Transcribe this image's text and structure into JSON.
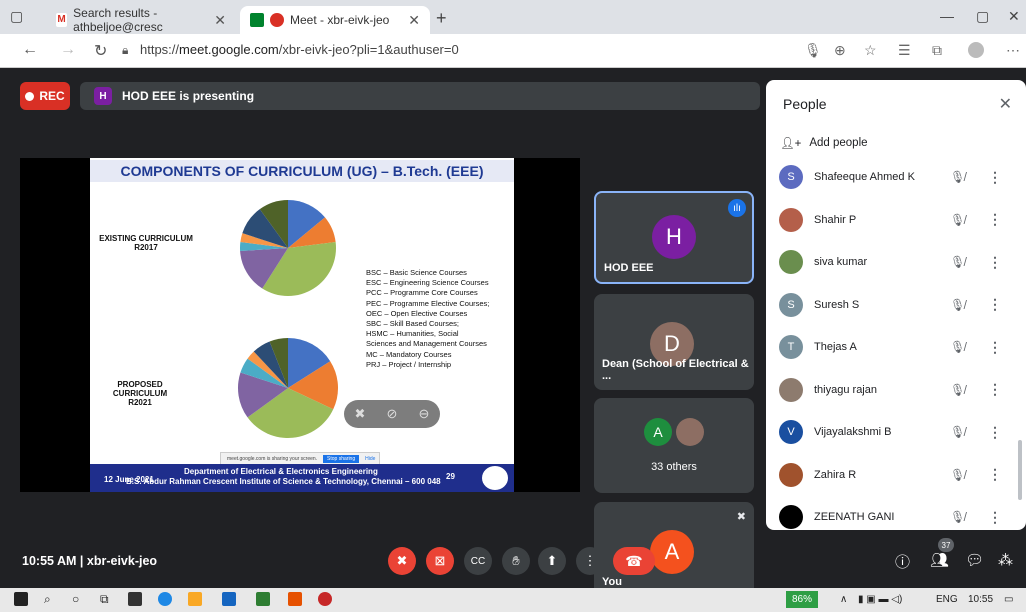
{
  "browser": {
    "tabs": [
      {
        "label": "Search results - athbeljoe@cresc",
        "active": false
      },
      {
        "label": "Meet - xbr-eivk-jeo",
        "active": true
      }
    ],
    "url_prefix": "https://",
    "url_host": "meet.google.com",
    "url_path": "/xbr-eivk-jeo?pli=1&authuser=0"
  },
  "meet": {
    "rec_label": "REC",
    "presenter_initial": "H",
    "presenting_text": "HOD EEE is presenting",
    "slide": {
      "title": "COMPONENTS OF CURRICULUM (UG) – B.Tech. (EEE)",
      "existing_label_1": "EXISTING CURRICULUM",
      "existing_label_2": "R2017",
      "proposed_label_1": "PROPOSED CURRICULUM",
      "proposed_label_2": "R2021",
      "legend": [
        "BSC – Basic Science Courses",
        "ESC – Engineering Science Courses",
        "PCC – Programme Core Courses",
        "PEC – Programme Elective Courses;",
        "OEC – Open Elective Courses",
        "SBC – Skill Based Courses;",
        "HSMC – Humanities, Social",
        "Sciences and Management Courses",
        "MC – Mandatory Courses",
        "PRJ – Project / Internship"
      ],
      "share_text": "meet.google.com is sharing your screen.",
      "stop_sharing": "Stop sharing",
      "hide": "Hide",
      "footer_date": "12 June 2021",
      "footer_dept": "Department of Electrical & Electronics Engineering",
      "footer_inst": "B.S. Abdur Rahman Crescent Institute of Science & Technology, Chennai – 600 048",
      "footer_page": "29",
      "pie_colors": [
        "#4472c4",
        "#ed7d31",
        "#9bbb59",
        "#8064a2",
        "#4bacc6",
        "#f79646",
        "#2c4d75",
        "#4f6228"
      ]
    },
    "tiles": [
      {
        "initial": "H",
        "name": "HOD EEE",
        "color": "#7b1fa2"
      },
      {
        "initial": "D",
        "name": "Dean (School of Electrical & ...",
        "color": "#8d6e63"
      },
      {
        "initial": "A",
        "name": "33 others",
        "color": "#1e8e3e"
      },
      {
        "initial": "A",
        "name": "You",
        "color": "#f4511e"
      }
    ],
    "clock": "10:55 AM",
    "separator": "|",
    "meeting_code": "xbr-eivk-jeo",
    "people_count": "37"
  },
  "people": {
    "title": "People",
    "add_people": "Add people",
    "list": [
      {
        "initial": "S",
        "name": "Shafeeque Ahmed K",
        "color": "#5c6bc0"
      },
      {
        "initial": "",
        "name": "Shahir P",
        "color": "#b45f4a"
      },
      {
        "initial": "",
        "name": "siva kumar",
        "color": "#6a8e4e"
      },
      {
        "initial": "S",
        "name": "Suresh S",
        "color": "#78909c"
      },
      {
        "initial": "T",
        "name": "Thejas A",
        "color": "#78909c"
      },
      {
        "initial": "",
        "name": "thiyagu rajan",
        "color": "#8d7b6e"
      },
      {
        "initial": "V",
        "name": "Vijayalakshmi B",
        "color": "#1a4fa0"
      },
      {
        "initial": "",
        "name": "Zahira R",
        "color": "#a0522d"
      },
      {
        "initial": "",
        "name": "ZEENATH GANI",
        "color": "#000000"
      }
    ]
  },
  "taskbar": {
    "battery": "86%",
    "lang": "ENG",
    "time": "10:55"
  }
}
